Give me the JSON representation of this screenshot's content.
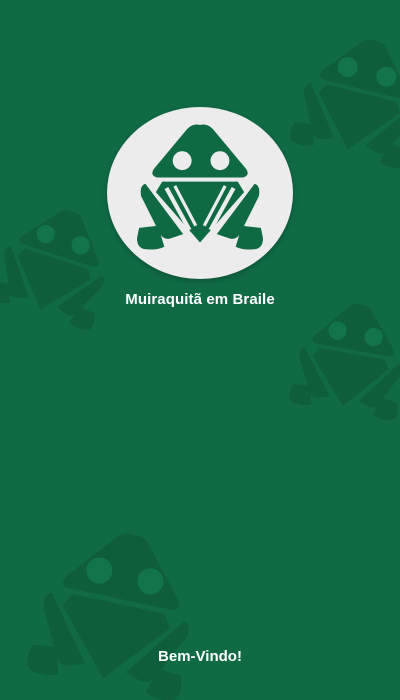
{
  "app": {
    "name": "Muiraquitã em Braile",
    "logo_icon": "frog-muiraquita-icon"
  },
  "splash": {
    "welcome_text": "Bem-Vindo!"
  },
  "colors": {
    "background": "#106b45",
    "background_frog": "#0e5e3c",
    "logo_circle": "#ececec",
    "logo_frog": "#0f6a43",
    "text": "#ffffff"
  }
}
